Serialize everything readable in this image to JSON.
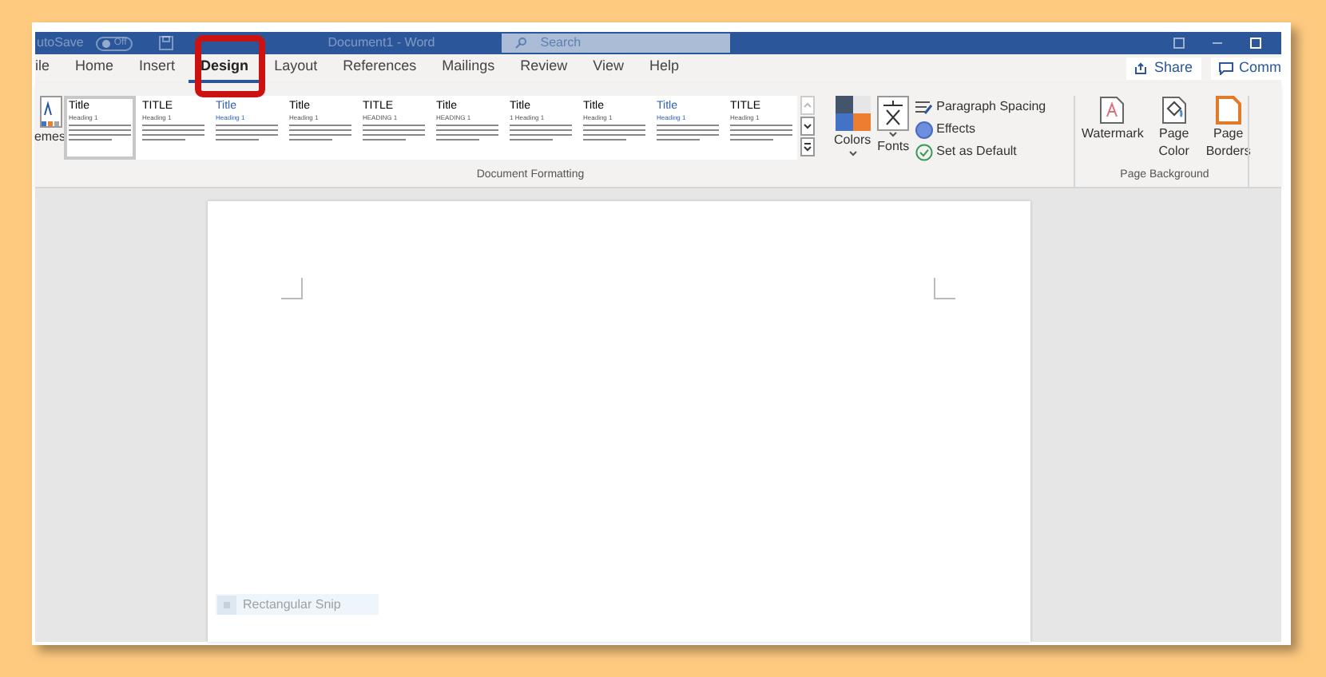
{
  "title_bar": {
    "autosave_label": "utoSave",
    "autosave_toggle": {
      "label": "Off",
      "on": false
    },
    "document_title": "Document1  -  Word",
    "search": {
      "placeholder": "Search"
    }
  },
  "tabs": [
    {
      "label": "ile",
      "selected": false
    },
    {
      "label": "Home",
      "selected": false
    },
    {
      "label": "Insert",
      "selected": false
    },
    {
      "label": "Design",
      "selected": true
    },
    {
      "label": "Layout",
      "selected": false
    },
    {
      "label": "References",
      "selected": false
    },
    {
      "label": "Mailings",
      "selected": false
    },
    {
      "label": "Review",
      "selected": false
    },
    {
      "label": "View",
      "selected": false
    },
    {
      "label": "Help",
      "selected": false
    }
  ],
  "share_button": "Share",
  "comments_button": "Comm",
  "themes_button": "emes",
  "style_gallery": [
    {
      "title": "Title",
      "heading": "Heading 1",
      "selected": true,
      "color": "#000000"
    },
    {
      "title": "TITLE",
      "heading": "Heading 1",
      "selected": false,
      "color": "#000000"
    },
    {
      "title": "Title",
      "heading": "Heading 1",
      "selected": false,
      "color": "#2f5fb3"
    },
    {
      "title": "Title",
      "heading": "Heading 1",
      "selected": false,
      "color": "#000000"
    },
    {
      "title": "TITLE",
      "heading": "HEADING 1",
      "selected": false,
      "color": "#000000"
    },
    {
      "title": "Title",
      "heading": "HEADING 1",
      "selected": false,
      "color": "#000000"
    },
    {
      "title": "Title",
      "heading": "1   Heading 1",
      "selected": false,
      "color": "#000000"
    },
    {
      "title": "Title",
      "heading": "Heading 1",
      "selected": false,
      "color": "#000000"
    },
    {
      "title": "Title",
      "heading": "Heading 1",
      "selected": false,
      "color": "#2f5fb3"
    },
    {
      "title": "TITLE",
      "heading": "Heading 1",
      "selected": false,
      "color": "#000000"
    }
  ],
  "colors_button": "Colors",
  "fonts_button": "Fonts",
  "paragraph_spacing": "Paragraph Spacing",
  "effects": "Effects",
  "set_as_default": "Set as Default",
  "group_document_formatting": "Document Formatting",
  "watermark_button": "Watermark",
  "page_color_button": "Page Color",
  "page_borders_button": "Page Borders",
  "group_page_background": "Page Background",
  "snip_tooltip": "Rectangular Snip"
}
